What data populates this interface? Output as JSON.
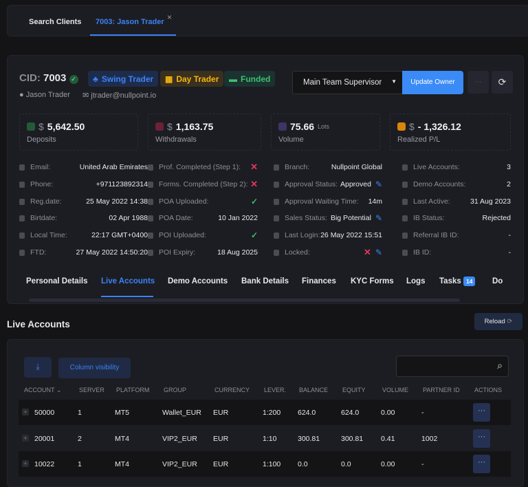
{
  "tabs": {
    "search": "Search Clients",
    "client": "7003: Jason Trader",
    "close": "×"
  },
  "header": {
    "cid_label": "CID:",
    "cid": "7003",
    "badges": [
      "Swing Trader",
      "Day Trader",
      "Funded"
    ],
    "name": "Jason Trader",
    "email": "jtrader@nullpoint.io",
    "owner_select": "Main Team Supervisor",
    "update_owner": "Update Owner",
    "more": "···"
  },
  "stats": [
    {
      "currency": "$",
      "value": "5,642.50",
      "label": "Deposits",
      "color": "#3fbf6f"
    },
    {
      "currency": "$",
      "value": "1,163.75",
      "label": "Withdrawals",
      "color": "#e0375a"
    },
    {
      "currency": "",
      "value": "75.66",
      "unit": "Lots",
      "label": "Volume",
      "color": "#7c5cd6"
    },
    {
      "currency": "$",
      "value": "- 1,326.12",
      "label": "Realized P/L",
      "color": "#f59e0b"
    }
  ],
  "info": {
    "col1": [
      {
        "k": "Email:",
        "v": "United Arab Emirates"
      },
      {
        "k": "Phone:",
        "v": "+971123892314"
      },
      {
        "k": "Reg.date:",
        "v": "25 May 2022 14:38"
      },
      {
        "k": "Birtdate:",
        "v": "02 Apr 1988"
      },
      {
        "k": "Local Time:",
        "v": "22:17 GMT+0400"
      },
      {
        "k": "FTD:",
        "v": "27 May 2022 14:50:20"
      }
    ],
    "col2": [
      {
        "k": "Prof. Completed (Step 1):",
        "status": "no"
      },
      {
        "k": "Forms. Completed (Step 2):",
        "status": "no"
      },
      {
        "k": "POA Uploaded:",
        "status": "yes"
      },
      {
        "k": "POA Date:",
        "v": "10 Jan 2022"
      },
      {
        "k": "POI Uploaded:",
        "status": "yes"
      },
      {
        "k": "POI Expiry:",
        "v": "18 Aug 2025"
      }
    ],
    "col3": [
      {
        "k": "Branch:",
        "v": "Nullpoint Global"
      },
      {
        "k": "Approval Status:",
        "v": "Approved"
      },
      {
        "k": "Approval Waiting Time:",
        "v": "14m"
      },
      {
        "k": "Sales Status:",
        "v": "Big Potential"
      },
      {
        "k": "Last Login:",
        "v": "26 May 2022 15:51"
      },
      {
        "k": "Locked:",
        "status": "no"
      }
    ],
    "col4": [
      {
        "k": "Live Accounts:",
        "v": "3"
      },
      {
        "k": "Demo Accounts:",
        "v": "2"
      },
      {
        "k": "Last Active:",
        "v": "31 Aug 2023"
      },
      {
        "k": "IB Status:",
        "v": "Rejected"
      },
      {
        "k": "Referral IB ID:",
        "v": "-"
      },
      {
        "k": "IB ID:",
        "v": "-"
      }
    ]
  },
  "nav": [
    "Personal Details",
    "Live Accounts",
    "Demo Accounts",
    "Bank Details",
    "Finances",
    "KYC Forms",
    "Logs",
    "Tasks",
    "Do"
  ],
  "tasks_badge": "14",
  "section": {
    "title": "Live Accounts",
    "reload": "Reload",
    "column_visibility": "Column visibility"
  },
  "table": {
    "columns": [
      "ACCOUNT",
      "SERVER",
      "PLATFORM",
      "GROUP",
      "CURRENCY",
      "LEVER.",
      "BALANCE",
      "EQUITY",
      "VOLUME",
      "PARTNER ID",
      "ACTIONS"
    ],
    "rows": [
      [
        "50000",
        "1",
        "MT5",
        "Wallet_EUR",
        "EUR",
        "1:200",
        "624.0",
        "624.0",
        "0.00",
        "-"
      ],
      [
        "20001",
        "2",
        "MT4",
        "VIP2_EUR",
        "EUR",
        "1:10",
        "300.81",
        "300.81",
        "0.41",
        "1002"
      ],
      [
        "10022",
        "1",
        "MT4",
        "VIP2_EUR",
        "EUR",
        "1:100",
        "0.0",
        "0.0",
        "0.00",
        "-"
      ]
    ]
  }
}
